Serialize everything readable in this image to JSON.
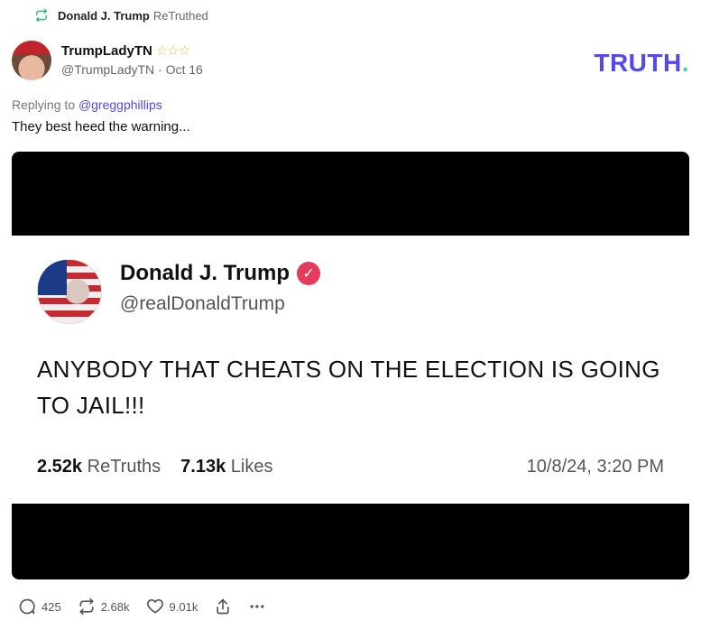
{
  "retruth": {
    "name": "Donald J. Trump",
    "suffix": "ReTruthed"
  },
  "author": {
    "display_name": "TrumpLadyTN",
    "stars": "☆☆☆",
    "handle_date": "@TrumpLadyTN · Oct 16"
  },
  "logo": {
    "text": "TRUTH",
    "dot": "."
  },
  "reply": {
    "prefix": "Replying to",
    "mention": "@greggphillips"
  },
  "post": {
    "text": "They best heed the warning..."
  },
  "embedded": {
    "display_name": "Donald J. Trump",
    "handle": "@realDonaldTrump",
    "text": "ANYBODY THAT CHEATS ON THE ELECTION IS GOING TO JAIL!!!",
    "retruths_count": "2.52k",
    "retruths_label": "ReTruths",
    "likes_count": "7.13k",
    "likes_label": "Likes",
    "timestamp": "10/8/24, 3:20 PM"
  },
  "actions": {
    "replies": "425",
    "retruths": "2.68k",
    "likes": "9.01k"
  },
  "colors": {
    "accent": "#5448ee",
    "logo_dot": "#40d9a4",
    "verified": "#e53b5c",
    "retruth_icon": "#2fbf71"
  }
}
